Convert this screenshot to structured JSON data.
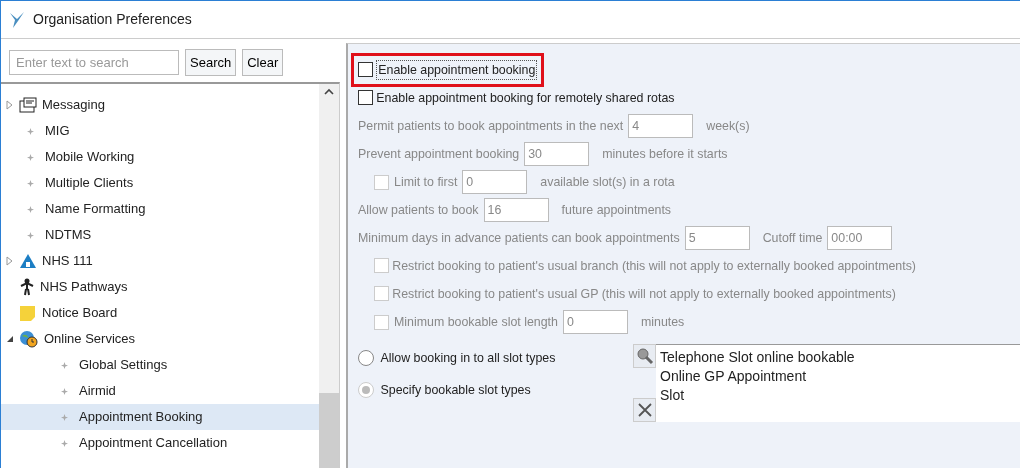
{
  "window": {
    "title": "Organisation Preferences"
  },
  "search": {
    "placeholder": "Enter text to search",
    "buttons": [
      "Search",
      "Clear"
    ]
  },
  "tree": [
    {
      "kind": "group",
      "label": "Messaging",
      "expanded": false,
      "selected": false
    },
    {
      "kind": "leaf",
      "label": "MIG",
      "selected": false
    },
    {
      "kind": "leaf",
      "label": "Mobile Working",
      "selected": false
    },
    {
      "kind": "leaf",
      "label": "Multiple Clients",
      "selected": false
    },
    {
      "kind": "leaf",
      "label": "Name Formatting",
      "selected": false
    },
    {
      "kind": "leaf",
      "label": "NDTMS",
      "selected": false
    },
    {
      "kind": "group",
      "label": "NHS 111",
      "expanded": false,
      "selected": false
    },
    {
      "kind": "item",
      "label": "NHS Pathways",
      "selected": false
    },
    {
      "kind": "item",
      "label": "Notice Board",
      "selected": false
    },
    {
      "kind": "group",
      "label": "Online Services",
      "expanded": true,
      "selected": false,
      "children": [
        {
          "kind": "leaf",
          "label": "Global Settings",
          "selected": false
        },
        {
          "kind": "leaf",
          "label": "Airmid",
          "selected": false
        },
        {
          "kind": "leaf",
          "label": "Appointment Booking",
          "selected": true
        },
        {
          "kind": "leaf",
          "label": "Appointment Cancellation",
          "selected": false
        }
      ]
    }
  ],
  "settings": [
    {
      "kind": "check",
      "label": "Enable appointment booking",
      "checked": false,
      "disabled": false,
      "highlighted": true
    },
    {
      "kind": "check",
      "label": "Enable appointment booking for remotely shared rotas",
      "checked": false,
      "disabled": false,
      "highlighted": false
    },
    {
      "kind": "fields",
      "disabled": true,
      "parts": [
        {
          "text": "Permit patients to book appointments in the next"
        },
        {
          "value": "4"
        },
        {
          "text": "week(s)"
        }
      ]
    },
    {
      "kind": "fields",
      "disabled": true,
      "parts": [
        {
          "text": "Prevent appointment booking"
        },
        {
          "value": "30"
        },
        {
          "text": "minutes before it starts"
        }
      ]
    },
    {
      "kind": "fields",
      "disabled": true,
      "check": {
        "checked": false
      },
      "parts": [
        {
          "text": "Limit to first"
        },
        {
          "value": "0"
        },
        {
          "text": "available slot(s) in a rota"
        }
      ]
    },
    {
      "kind": "fields",
      "disabled": true,
      "parts": [
        {
          "text": "Allow patients to book"
        },
        {
          "value": "16"
        },
        {
          "text": "future appointments"
        }
      ]
    },
    {
      "kind": "fields",
      "disabled": true,
      "parts": [
        {
          "text": "Minimum days in advance patients can book appointments"
        },
        {
          "value": "5"
        },
        {
          "text": "Cutoff time"
        },
        {
          "value": "00:00"
        }
      ]
    },
    {
      "kind": "check",
      "label": "Restrict booking to patient's usual branch (this will not apply to externally booked appointments)",
      "checked": false,
      "disabled": true,
      "highlighted": false
    },
    {
      "kind": "check",
      "label": "Restrict booking to patient's usual GP (this will not apply to externally booked appointments)",
      "checked": false,
      "disabled": true,
      "highlighted": false
    },
    {
      "kind": "fields",
      "disabled": true,
      "check": {
        "checked": false
      },
      "parts": [
        {
          "text": "Minimum bookable slot length"
        },
        {
          "value": "0"
        },
        {
          "text": "minutes"
        }
      ]
    }
  ],
  "slot_options": [
    {
      "label": "Allow booking in to all slot types",
      "selected": false,
      "disabled": false
    },
    {
      "label": "Specify bookable slot types",
      "selected": true,
      "disabled": true
    }
  ],
  "slot_types": [
    "Telephone Slot online bookable",
    "Online GP Appointment",
    "Slot"
  ]
}
